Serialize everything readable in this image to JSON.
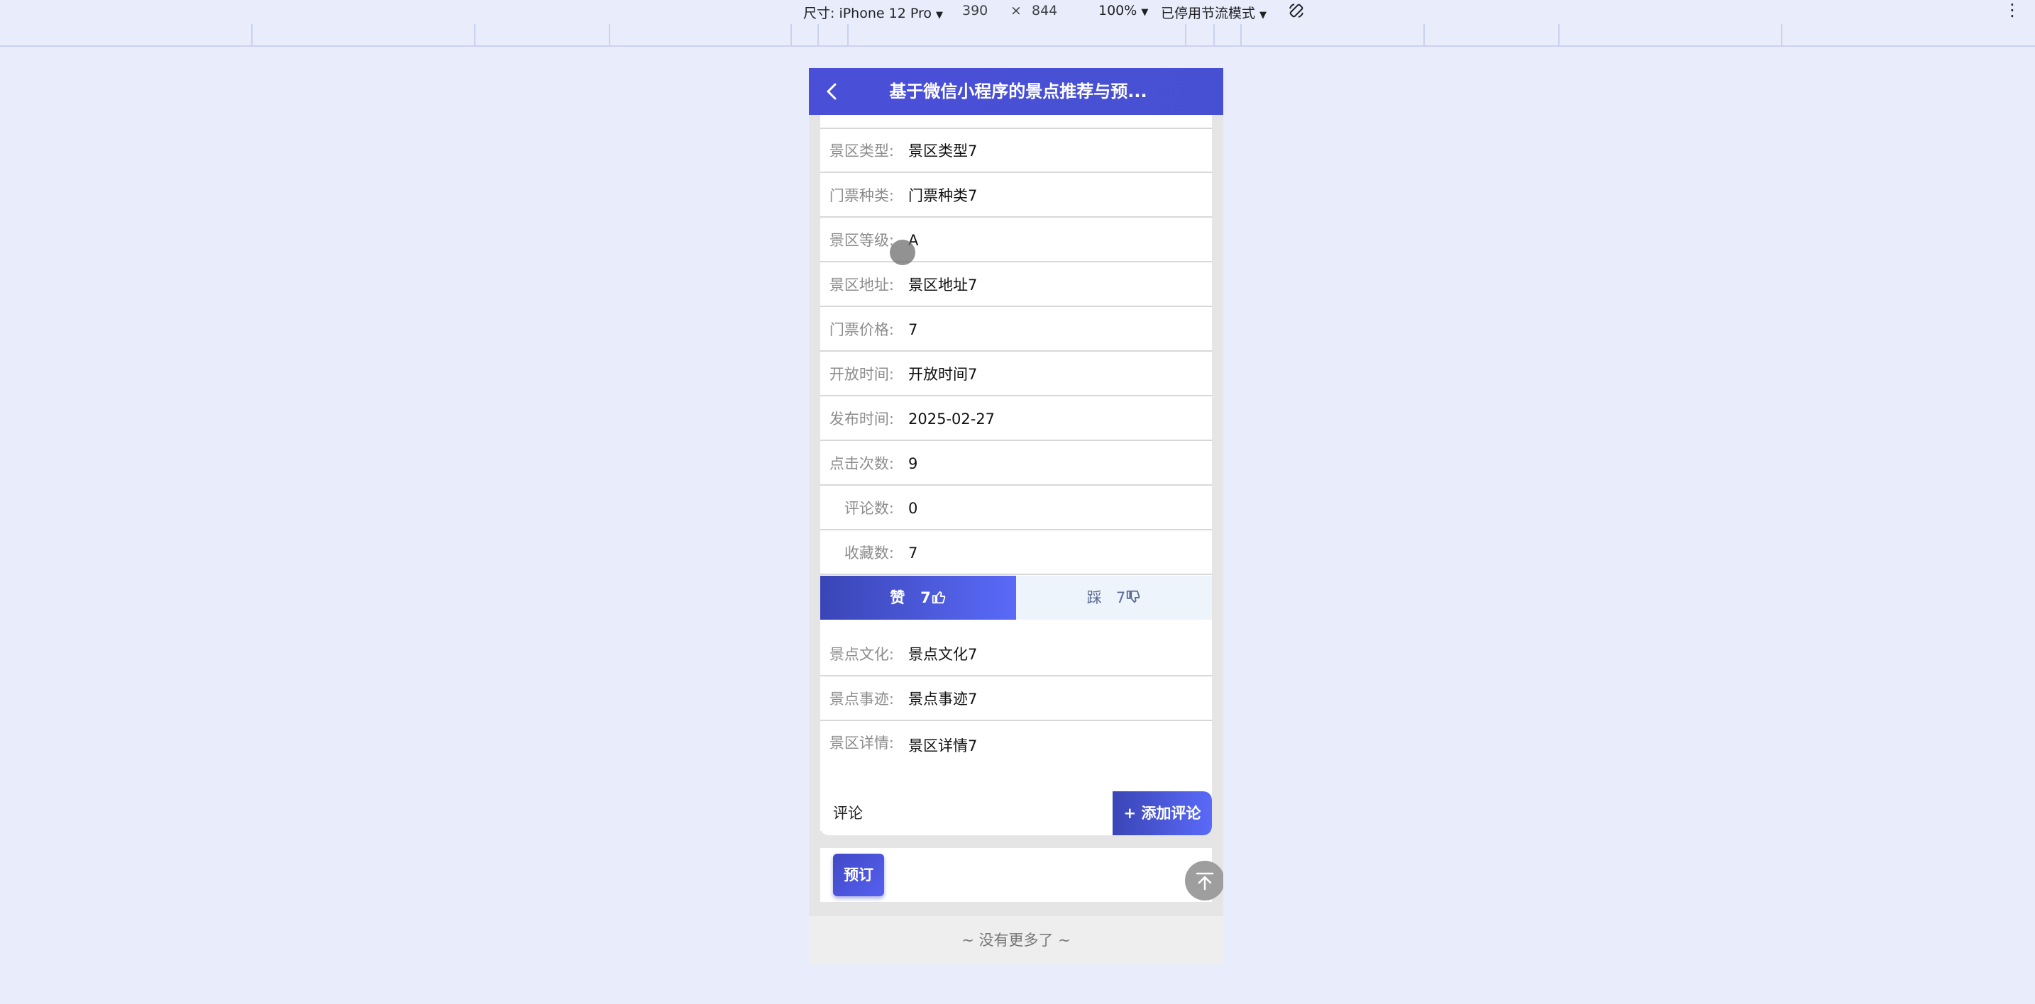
{
  "devtools": {
    "device_label": "尺寸: iPhone 12 Pro",
    "width": "390",
    "times": "×",
    "height": "844",
    "zoom": "100%",
    "throttle": "已停用节流模式",
    "more": "⋮"
  },
  "navbar": {
    "title": "基于微信小程序的景点推荐与预..."
  },
  "details": [
    {
      "label": "景区类型:",
      "value": "景区类型7"
    },
    {
      "label": "门票种类:",
      "value": "门票种类7"
    },
    {
      "label": "景区等级:",
      "value": "A"
    },
    {
      "label": "景区地址:",
      "value": "景区地址7"
    },
    {
      "label": "门票价格:",
      "value": "7"
    },
    {
      "label": "开放时间:",
      "value": "开放时间7"
    },
    {
      "label": "发布时间:",
      "value": "2025-02-27"
    },
    {
      "label": "点击次数:",
      "value": "9"
    },
    {
      "label": "评论数:",
      "value": "0"
    },
    {
      "label": "收藏数:",
      "value": "7"
    }
  ],
  "votes": {
    "up_label": "赞",
    "up_count": "7",
    "down_label": "踩",
    "down_count": "7"
  },
  "extra": [
    {
      "label": "景点文化:",
      "value": "景点文化7"
    },
    {
      "label": "景点事迹:",
      "value": "景点事迹7"
    },
    {
      "label": "景区详情:",
      "value": "景区详情7"
    }
  ],
  "comment": {
    "label": "评论",
    "add_button": "+ 添加评论"
  },
  "booking": {
    "button": "预订"
  },
  "footer": {
    "text": "~ 没有更多了 ~"
  }
}
